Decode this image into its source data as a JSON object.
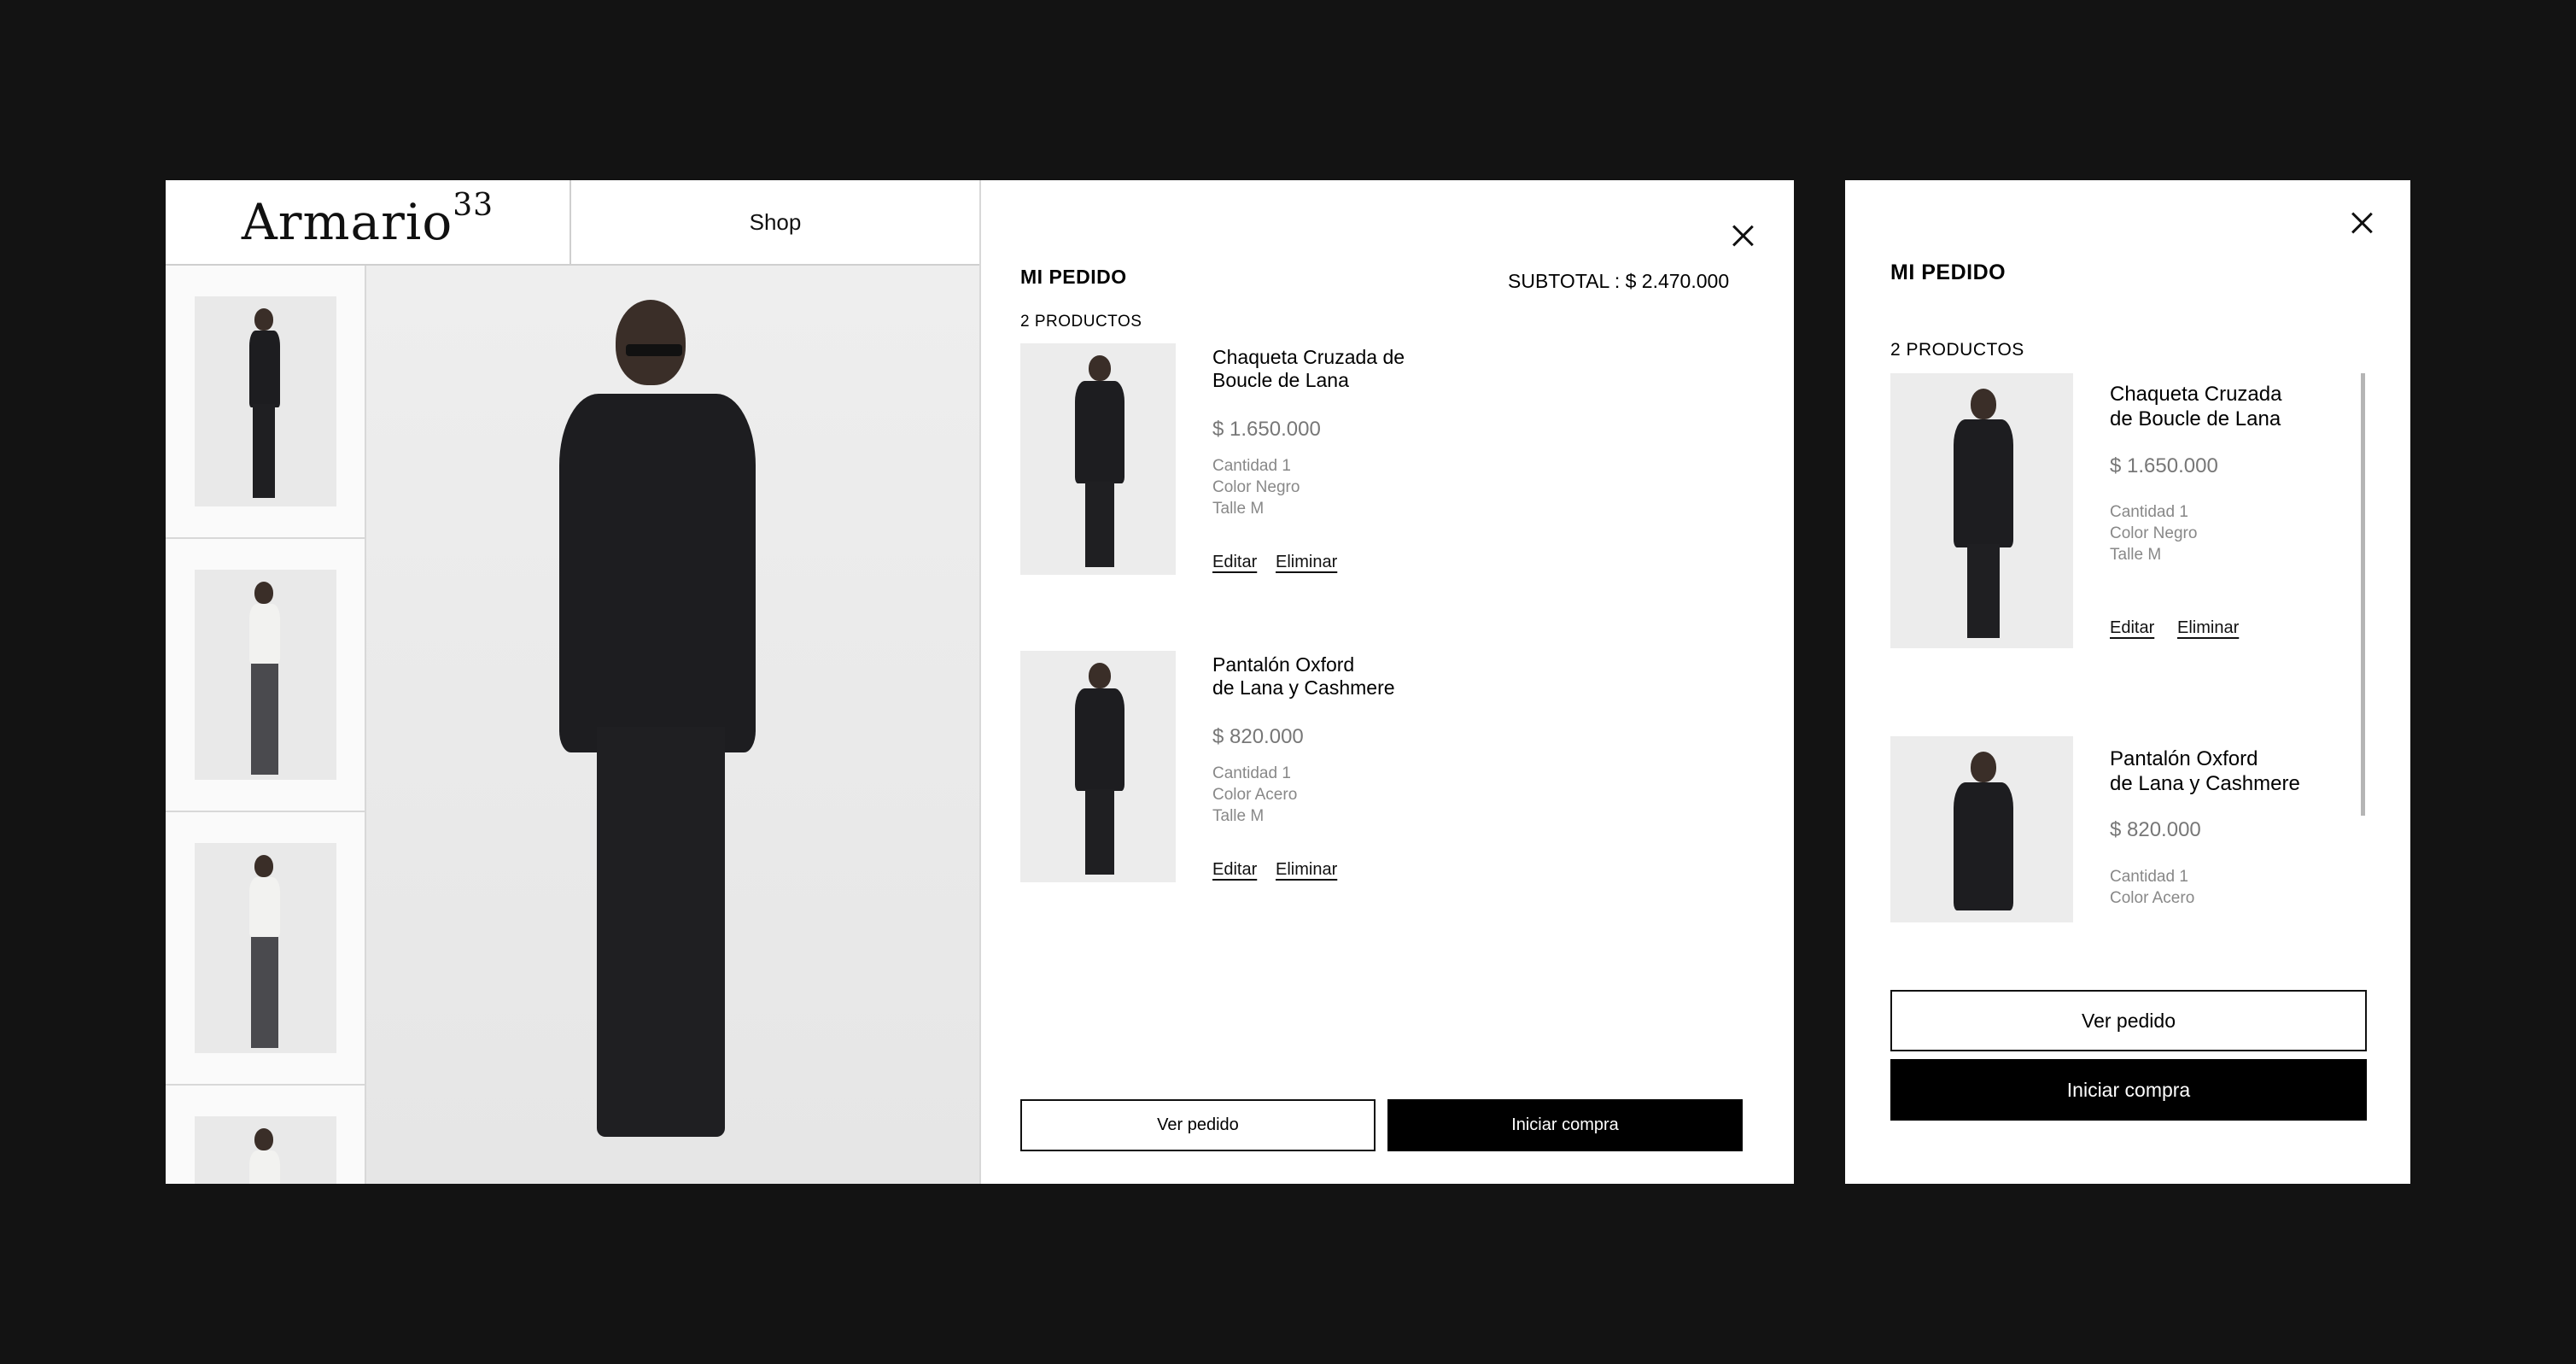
{
  "brand": {
    "logo": "Armario",
    "logo_sup": "33",
    "nav_shop": "Shop"
  },
  "cart": {
    "title": "MI PEDIDO",
    "subtotal": "SUBTOTAL : $ 2.470.000",
    "count": "2 PRODUCTOS",
    "items": [
      {
        "name_line1": "Chaqueta Cruzada de",
        "name_line2": "Boucle de Lana",
        "price": "$ 1.650.000",
        "quantity": "Cantidad 1",
        "color": "Color Negro",
        "size": "Talle M",
        "edit": "Editar",
        "remove": "Eliminar"
      },
      {
        "name_line1": "Pantalón Oxford",
        "name_line2": "de Lana y Cashmere",
        "price": "$ 820.000",
        "quantity": "Cantidad 1",
        "color": "Color Acero",
        "size": "Talle M",
        "edit": "Editar",
        "remove": "Eliminar"
      }
    ],
    "view_order": "Ver pedido",
    "checkout": "Iniciar compra"
  },
  "mobile_cart": {
    "title": "MI PEDIDO",
    "count": "2 PRODUCTOS",
    "items": [
      {
        "name_line1": "Chaqueta Cruzada",
        "name_line2": "de Boucle de Lana",
        "price": "$ 1.650.000",
        "quantity": "Cantidad 1",
        "color": "Color Negro",
        "size": "Talle M",
        "edit": "Editar",
        "remove": "Eliminar"
      },
      {
        "name_line1": "Pantalón Oxford",
        "name_line2": "de Lana y Cashmere",
        "price": "$ 820.000",
        "quantity": "Cantidad 1",
        "color": "Color Acero"
      }
    ],
    "view_order": "Ver pedido",
    "checkout": "Iniciar compra"
  },
  "icons": {
    "close": "close-icon"
  },
  "colors": {
    "background": "#131313",
    "panel": "#ffffff",
    "primary_button": "#000000"
  }
}
